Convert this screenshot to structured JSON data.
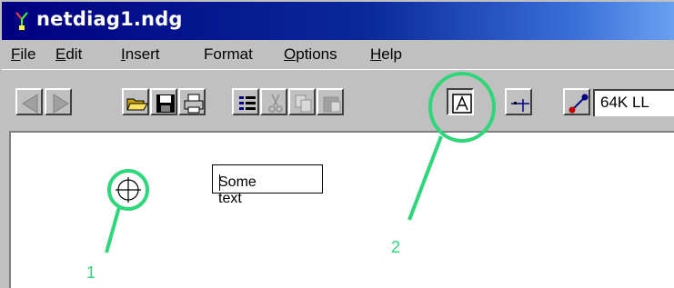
{
  "window": {
    "title": "netdiag1.ndg"
  },
  "menu": {
    "items": [
      {
        "accel": "F",
        "rest": "ile"
      },
      {
        "accel": "E",
        "rest": "dit"
      },
      {
        "accel": "I",
        "rest": "nsert"
      },
      {
        "accel": "",
        "rest": "Format"
      },
      {
        "accel": "O",
        "rest": "ptions"
      },
      {
        "accel": "H",
        "rest": "elp"
      }
    ]
  },
  "toolbar": {
    "buttons": [
      {
        "icon": "back-arrow-icon",
        "enabled": false
      },
      {
        "icon": "forward-arrow-icon",
        "enabled": false
      },
      {
        "icon": "open-folder-icon",
        "enabled": true
      },
      {
        "icon": "save-disk-icon",
        "enabled": true
      },
      {
        "icon": "print-icon",
        "enabled": true
      },
      {
        "icon": "properties-list-icon",
        "enabled": true
      },
      {
        "icon": "cut-icon",
        "enabled": false
      },
      {
        "icon": "copy-icon",
        "enabled": false
      },
      {
        "icon": "paste-icon",
        "enabled": false
      },
      {
        "icon": "text-tool-icon",
        "enabled": true,
        "pressed": true
      },
      {
        "icon": "node-tool-icon",
        "enabled": true
      },
      {
        "icon": "link-tool-icon",
        "enabled": true
      }
    ],
    "link_type_value": "64K LL"
  },
  "canvas": {
    "text_object": "Some text"
  },
  "annotations": {
    "color": "#2fd67a",
    "labels": [
      "1",
      "2"
    ]
  }
}
